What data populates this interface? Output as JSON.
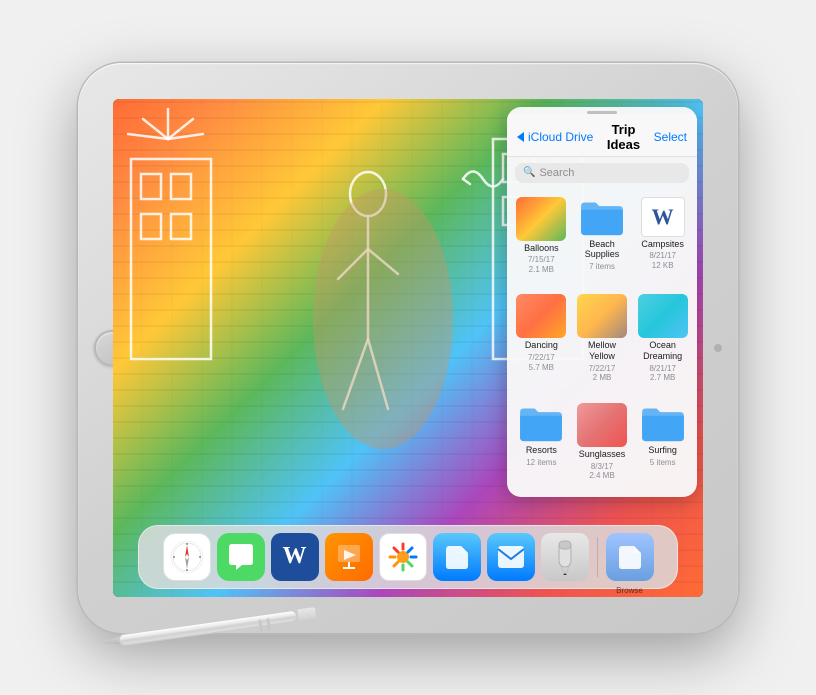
{
  "ipad": {
    "screen": {
      "background": "colorful wall art with woman"
    }
  },
  "panel": {
    "back_label": "iCloud Drive",
    "title": "Trip Ideas",
    "select_label": "Select",
    "search_placeholder": "Search",
    "files": [
      {
        "name": "Balloons",
        "meta": "7/15/17",
        "meta2": "2.1 MB",
        "type": "image",
        "thumb": "balloons"
      },
      {
        "name": "Beach Supplies",
        "meta": "7 items",
        "type": "folder",
        "thumb": "folder"
      },
      {
        "name": "Campsites",
        "meta": "8/21/17",
        "meta2": "12 KB",
        "type": "word",
        "thumb": "word"
      },
      {
        "name": "Dancing",
        "meta": "7/22/17",
        "meta2": "5.7 MB",
        "type": "image",
        "thumb": "dancing"
      },
      {
        "name": "Mellow Yellow",
        "meta": "7/22/17",
        "meta2": "2 MB",
        "type": "image",
        "thumb": "mellow"
      },
      {
        "name": "Ocean Dreaming",
        "meta": "8/21/17",
        "meta2": "2.7 MB",
        "type": "image",
        "thumb": "ocean"
      },
      {
        "name": "Resorts",
        "meta": "12 items",
        "type": "folder",
        "thumb": "folder"
      },
      {
        "name": "Sunglasses",
        "meta": "8/3/17",
        "meta2": "2.4 MB",
        "type": "image",
        "thumb": "sunglasses"
      },
      {
        "name": "Surfing",
        "meta": "5 items",
        "type": "folder",
        "thumb": "folder"
      }
    ]
  },
  "dock": {
    "apps": [
      {
        "name": "Safari",
        "label": ""
      },
      {
        "name": "Messages",
        "label": ""
      },
      {
        "name": "Word",
        "label": ""
      },
      {
        "name": "Keynote",
        "label": ""
      },
      {
        "name": "Photos",
        "label": ""
      },
      {
        "name": "Files",
        "label": ""
      },
      {
        "name": "Mail",
        "label": ""
      },
      {
        "name": "Pencil",
        "label": ""
      },
      {
        "name": "Browse",
        "label": "Browse"
      }
    ]
  }
}
